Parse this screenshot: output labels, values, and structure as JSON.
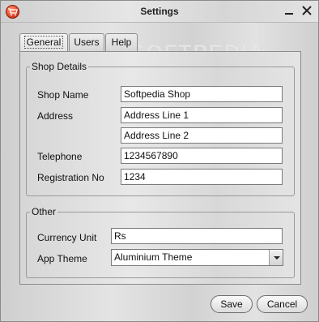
{
  "window": {
    "title": "Settings",
    "watermark": "SOFTPEDIA"
  },
  "tabs": [
    {
      "label": "General",
      "active": true
    },
    {
      "label": "Users",
      "active": false
    },
    {
      "label": "Help",
      "active": false
    }
  ],
  "shop_details": {
    "legend": "Shop Details",
    "shop_name_label": "Shop Name",
    "shop_name_value": "Softpedia Shop",
    "address_label": "Address",
    "address_line1_value": "Address Line 1",
    "address_line2_value": "Address Line 2",
    "telephone_label": "Telephone",
    "telephone_value": "1234567890",
    "registration_label": "Registration No",
    "registration_value": "1234"
  },
  "other": {
    "legend": "Other",
    "currency_label": "Currency Unit",
    "currency_value": "Rs",
    "theme_label": "App Theme",
    "theme_value": "Aluminium Theme"
  },
  "buttons": {
    "save": "Save",
    "cancel": "Cancel"
  },
  "icons": {
    "app": "shopping-cart-icon",
    "minimize": "minimize-icon",
    "close": "close-icon",
    "dropdown": "chevron-down-icon"
  }
}
